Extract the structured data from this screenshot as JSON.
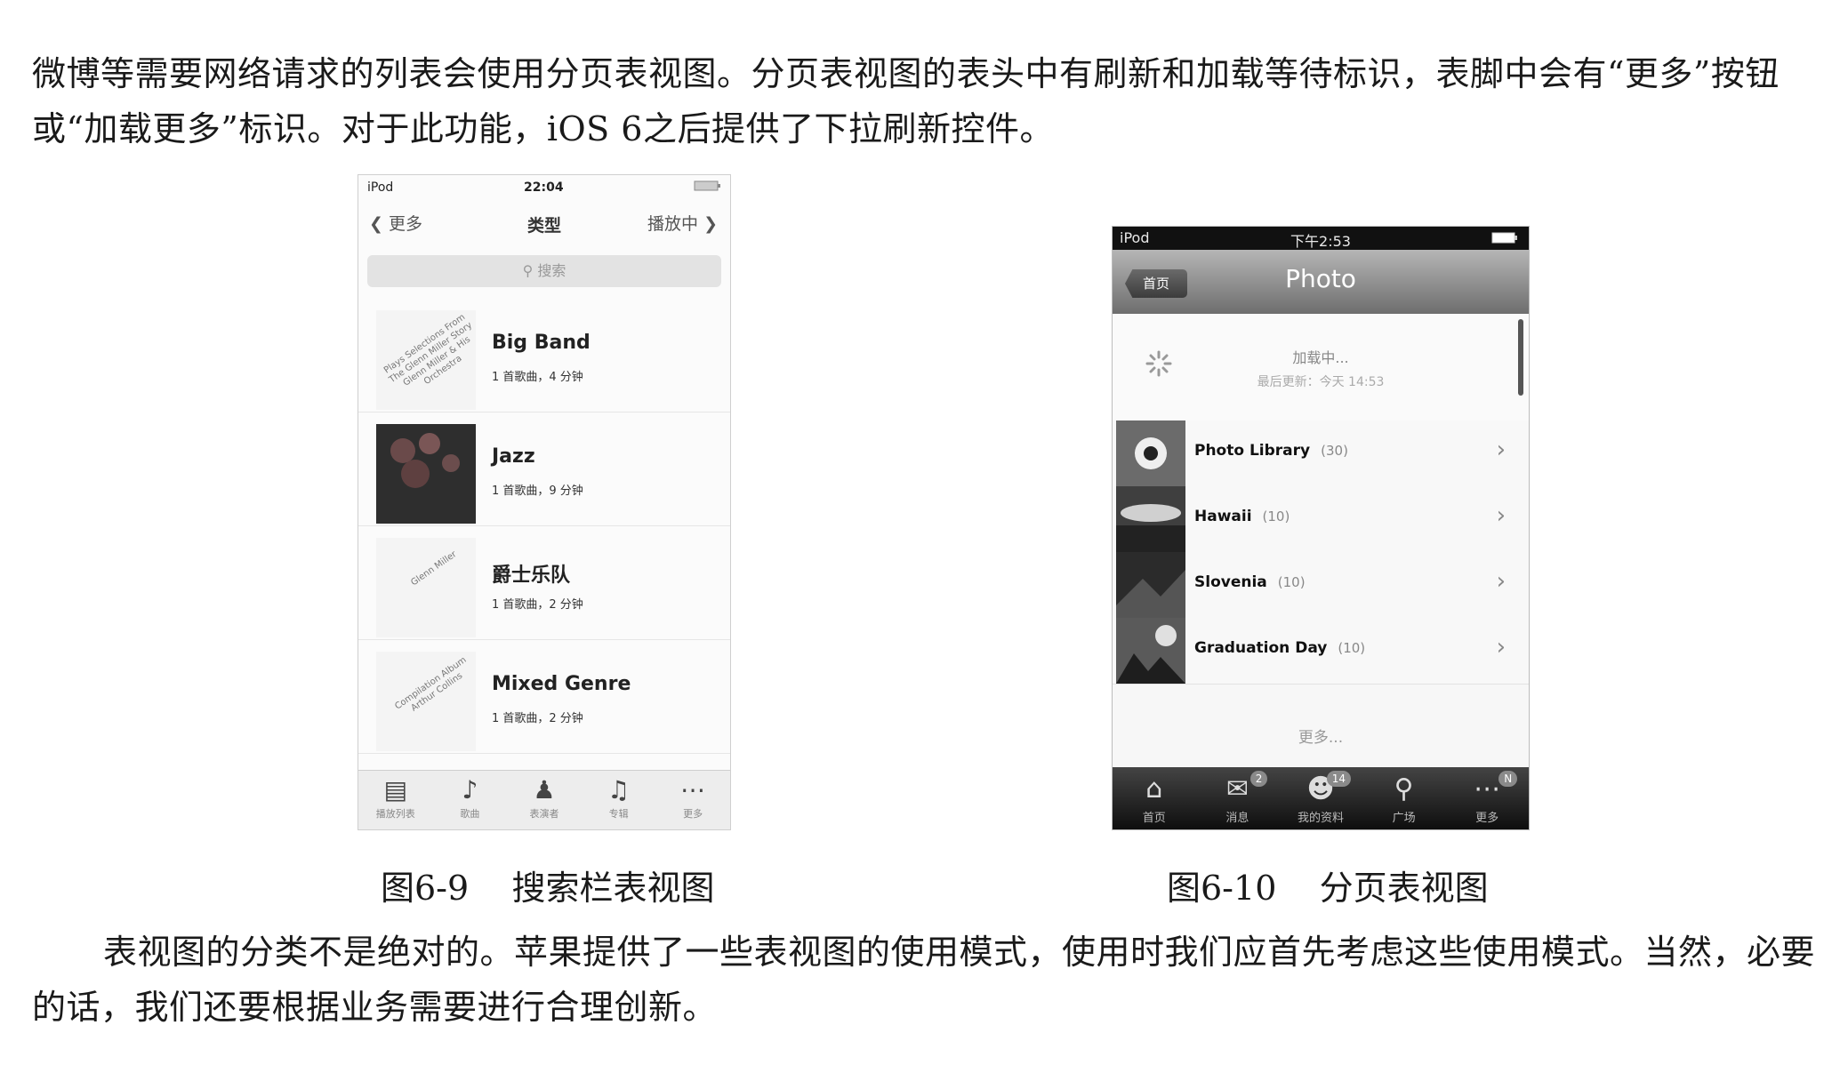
{
  "paragraph_top": "微博等需要网络请求的列表会使用分页表视图。分页表视图的表头中有刷新和加载等待标识，表脚中会有“更多”按钮或“加载更多”标识。对于此功能，iOS 6之后提供了下拉刷新控件。",
  "paragraph_bottom": "表视图的分类不是绝对的。苹果提供了一些表视图的使用模式，使用时我们应首先考虑这些使用模式。当然，必要的话，我们还要根据业务需要进行合理创新。",
  "figure1": {
    "caption": "图6-9    搜索栏表视图",
    "status": {
      "carrier": "iPod",
      "time": "22:04"
    },
    "nav": {
      "back": "更多",
      "title": "类型",
      "right": "播放中"
    },
    "search_placeholder": "搜索",
    "rows": [
      {
        "name": "Big Band",
        "sub": "1 首歌曲，4 分钟",
        "art_text": "Plays Selections From The Glenn Miller Story Glenn Miller & His Orchestra"
      },
      {
        "name": "Jazz",
        "sub": "1 首歌曲，9 分钟",
        "art_text": ""
      },
      {
        "name": "爵士乐队",
        "sub": "1 首歌曲，2 分钟",
        "art_text": "Glenn Miller"
      },
      {
        "name": "Mixed Genre",
        "sub": "1 首歌曲，2 分钟",
        "art_text": "Compilation Album Arthur Collins"
      }
    ],
    "tabs": [
      {
        "label": "播放列表",
        "icon": "playlist-icon"
      },
      {
        "label": "歌曲",
        "icon": "music-note-icon"
      },
      {
        "label": "表演者",
        "icon": "artist-icon"
      },
      {
        "label": "专辑",
        "icon": "album-icon"
      },
      {
        "label": "更多",
        "icon": "more-icon"
      }
    ]
  },
  "figure2": {
    "caption": "图6-10    分页表视图",
    "status": {
      "carrier": "iPod",
      "time": "下午2:53"
    },
    "nav": {
      "back": "首页",
      "title": "Photo"
    },
    "loading": {
      "text": "加载中...",
      "updated": "最后更新：今天 14:53"
    },
    "rows": [
      {
        "name": "Photo Library",
        "count": "(30)"
      },
      {
        "name": "Hawaii",
        "count": "(10)"
      },
      {
        "name": "Slovenia",
        "count": "(10)"
      },
      {
        "name": "Graduation Day",
        "count": "(10)"
      }
    ],
    "more": "更多...",
    "tabs": [
      {
        "label": "首页",
        "badge": "",
        "icon": "home-icon"
      },
      {
        "label": "消息",
        "badge": "2",
        "icon": "mail-icon"
      },
      {
        "label": "我的资料",
        "badge": "14",
        "icon": "profile-icon"
      },
      {
        "label": "广场",
        "badge": "",
        "icon": "search-icon"
      },
      {
        "label": "更多",
        "badge": "N",
        "icon": "more-icon"
      }
    ]
  }
}
